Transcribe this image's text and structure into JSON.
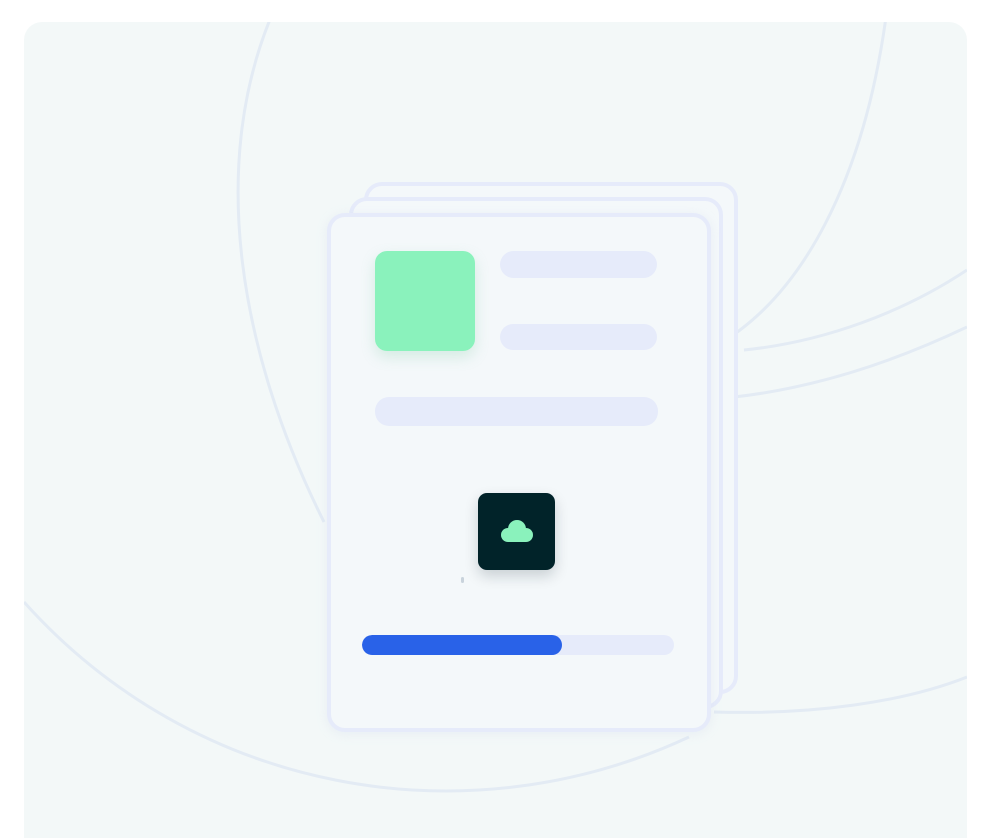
{
  "colors": {
    "panel_background": "#f3f8f8",
    "sheet_border": "#e6ebfa",
    "skeleton": "#e6ebfa",
    "thumbnail": "#8af2bc",
    "cloud_tile_background": "#012329",
    "cloud_icon": "#8af2bc",
    "progress_track": "#e6ebfa",
    "progress_fill": "#2962e8",
    "background_arcs": "#e3ebf4"
  },
  "icons": {
    "cloud": "cloud-icon"
  },
  "upload": {
    "progress": 0.64
  }
}
